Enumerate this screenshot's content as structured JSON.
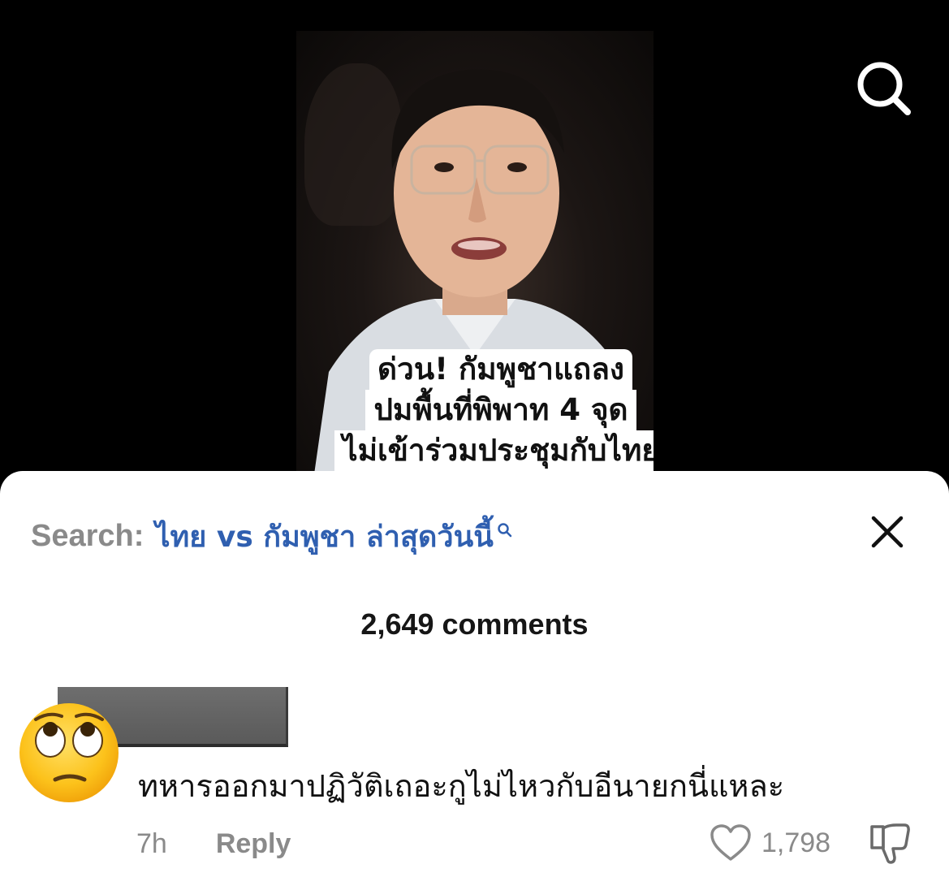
{
  "video": {
    "caption_lines": [
      "ด่วน! กัมพูชาแถลง",
      "ปมพื้นที่พิพาท 4 จุด",
      "ไม่เข้าร่วมประชุมกับไทย"
    ],
    "top_search_icon": "search-icon"
  },
  "sheet": {
    "search_label": "Search:",
    "search_query": "ไทย vs กัมพูชา ล่าสุดวันนี้",
    "close_icon": "close-icon",
    "comment_count": "2,649 comments"
  },
  "comment": {
    "avatar_icon": "eye-roll-emoji-avatar",
    "text": "ทหารออกมาปฏิวัติเถอะกูไม่ไหวกับอีนายกนี่แหละ",
    "time": "7h",
    "reply_label": "Reply",
    "like_count": "1,798",
    "like_icon": "heart-icon",
    "dislike_icon": "thumbs-down-icon"
  },
  "colors": {
    "background": "#000000",
    "sheet": "#ffffff",
    "query_blue": "#2f5fb0",
    "muted_gray": "#8a8a8a"
  }
}
